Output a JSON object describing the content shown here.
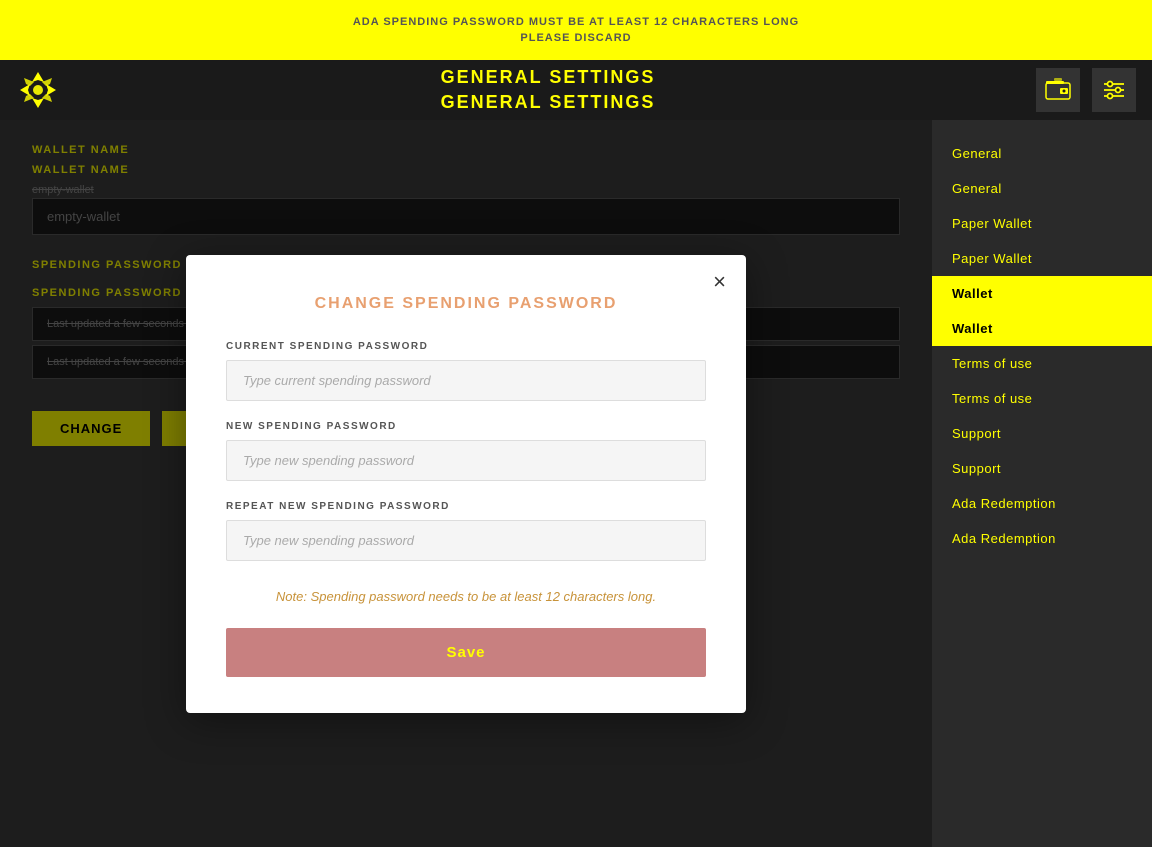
{
  "top_banner": {
    "line1": "ADA SPENDING PASSWORD MUST BE AT LEAST 12 CHARACTERS LONG",
    "line2": "PLEASE DISCARD"
  },
  "header": {
    "title_line1": "GENERAL SETTINGS",
    "title_line2": "GENERAL SETTINGS",
    "logo_alt": "Cardano Logo"
  },
  "sidebar": {
    "items": [
      {
        "label": "General",
        "active": false
      },
      {
        "label": "General",
        "active": false
      },
      {
        "label": "Paper Wallet",
        "active": false
      },
      {
        "label": "Paper Wallet",
        "active": false
      },
      {
        "label": "Wallet",
        "active": true
      },
      {
        "label": "Wallet",
        "active": true
      },
      {
        "label": "Terms of use",
        "active": false
      },
      {
        "label": "Terms of use",
        "active": false
      },
      {
        "label": "Support",
        "active": false
      },
      {
        "label": "Support",
        "active": false
      },
      {
        "label": "Ada Redemption",
        "active": false
      },
      {
        "label": "Ada Redemption",
        "active": false
      }
    ]
  },
  "content": {
    "wallet_name_label": "WALLET NAME",
    "wallet_name_field_label": "WALLET NAME",
    "wallet_name_value": "empty-wallet",
    "wallet_name_subtext": "empty-wallet",
    "spending_password_label": "SPENDING PASSWORD",
    "spending_password_field_label": "SPENDING PASSWORD",
    "spending_last_updated": "Last updated a few seconds ago",
    "spending_last_updated2": "Last updated a few seconds ago",
    "change_button_label": "CHANGE"
  },
  "modal": {
    "title": "CHANGE SPENDING PASSWORD",
    "current_password_label": "CURRENT SPENDING PASSWORD",
    "current_password_placeholder": "Type current spending password",
    "new_password_label": "NEW SPENDING PASSWORD",
    "new_password_placeholder": "Type new spending password",
    "repeat_password_label": "REPEAT NEW SPENDING PASSWORD",
    "repeat_password_placeholder": "Type new spending password",
    "note": "Note: Spending password needs to be at least 12 characters long.",
    "save_button": "Save",
    "close_icon": "×"
  }
}
